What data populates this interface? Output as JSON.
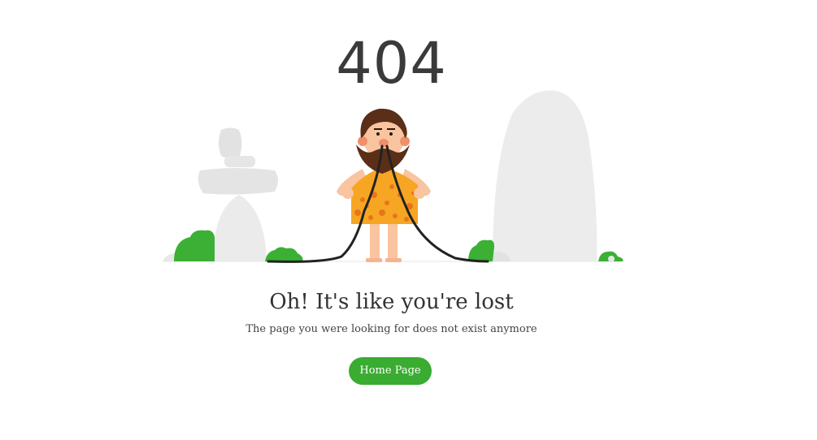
{
  "error": {
    "code": "404"
  },
  "message": {
    "headline": "Oh! It's like you're lost",
    "subtext": "The page you were looking for does not exist anymore"
  },
  "actions": {
    "home_label": "Home Page"
  },
  "illustration": {
    "subject": "caveman-holding-cable",
    "colors": {
      "button": "#39ac31",
      "rock": "#e9e9e9",
      "bush": "#3bb035",
      "tunic": "#f6a623",
      "tunic_spots": "#e8751b",
      "beard": "#5a2e17",
      "skin": "#f9c4a0",
      "cable": "#222222"
    }
  }
}
